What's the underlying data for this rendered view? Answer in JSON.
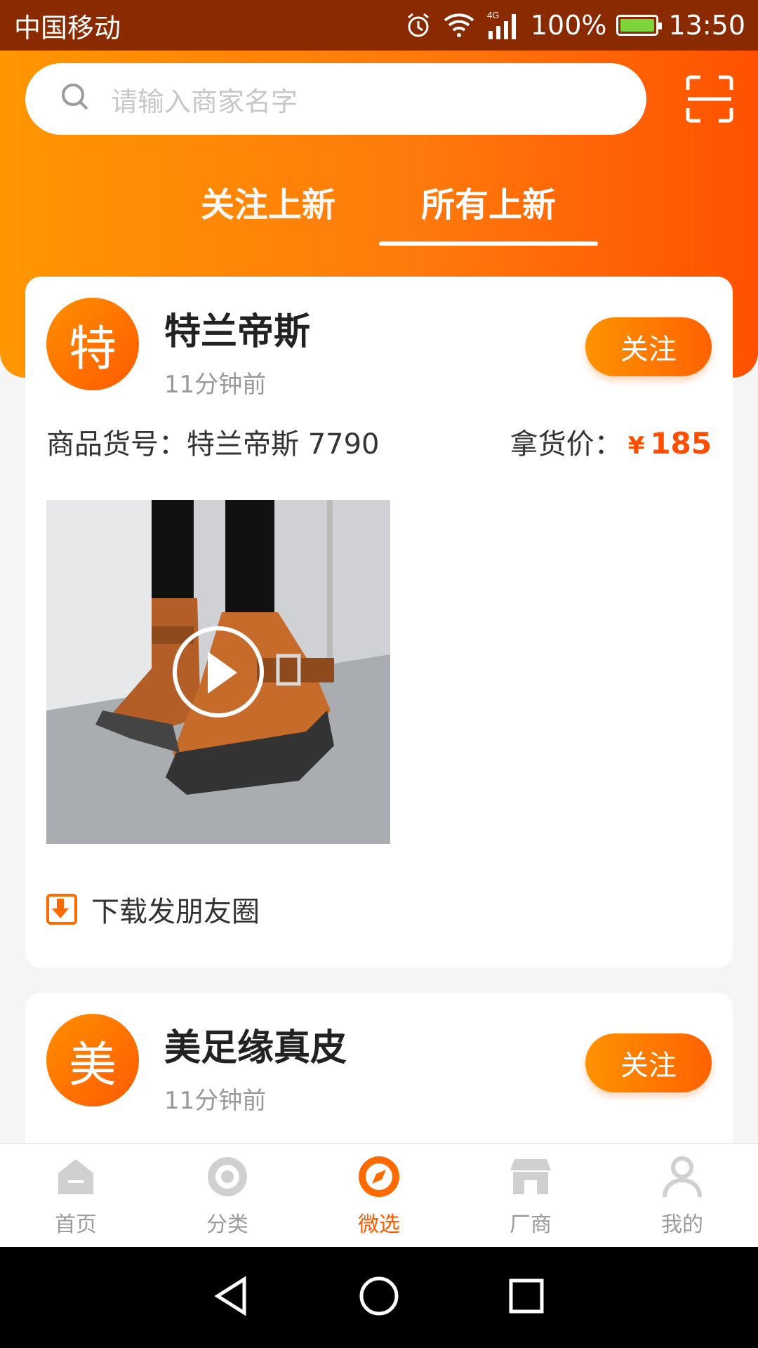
{
  "status_bar": {
    "carrier": "中国移动",
    "network": "4G",
    "battery": "100%",
    "time": "13:50"
  },
  "search": {
    "placeholder": "请输入商家名字"
  },
  "tabs": [
    {
      "label": "关注上新",
      "active": false
    },
    {
      "label": "所有上新",
      "active": true
    }
  ],
  "cards": [
    {
      "avatar_text": "特",
      "merchant": "特兰帝斯",
      "time": "11分钟前",
      "follow_label": "关注",
      "sku_label": "商品货号：",
      "sku": "特兰帝斯 7790",
      "price_label": "拿货价：",
      "currency": "¥",
      "price": "185",
      "download_label": "下载发朋友圈"
    },
    {
      "avatar_text": "美",
      "merchant": "美足缘真皮",
      "time": "11分钟前",
      "follow_label": "关注"
    }
  ],
  "bottom_nav": [
    {
      "label": "首页",
      "icon": "home-icon",
      "active": false
    },
    {
      "label": "分类",
      "icon": "category-icon",
      "active": false
    },
    {
      "label": "微选",
      "icon": "compass-icon",
      "active": true
    },
    {
      "label": "厂商",
      "icon": "store-icon",
      "active": false
    },
    {
      "label": "我的",
      "icon": "user-icon",
      "active": false
    }
  ],
  "colors": {
    "accent": "#ff6a00",
    "status_bar": "#8a2a00"
  }
}
